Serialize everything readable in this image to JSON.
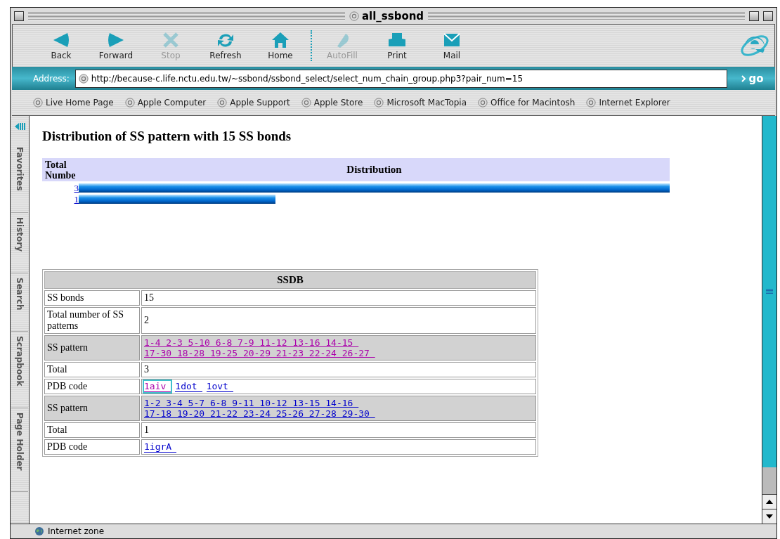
{
  "window": {
    "title": "all_ssbond"
  },
  "toolbar": [
    {
      "label": "Back",
      "disabled": false
    },
    {
      "label": "Forward",
      "disabled": false
    },
    {
      "label": "Stop",
      "disabled": true
    },
    {
      "label": "Refresh",
      "disabled": false
    },
    {
      "label": "Home",
      "disabled": false
    },
    {
      "label": "AutoFill",
      "disabled": true
    },
    {
      "label": "Print",
      "disabled": false
    },
    {
      "label": "Mail",
      "disabled": false
    }
  ],
  "address": {
    "label": "Address:",
    "value": "http://because-c.life.nctu.edu.tw/~ssbond/ssbond_select/select_num_chain_group.php3?pair_num=15",
    "go": "go"
  },
  "favorites": [
    "Live Home Page",
    "Apple Computer",
    "Apple Support",
    "Apple Store",
    "Microsoft MacTopia",
    "Office for Macintosh",
    "Internet Explorer"
  ],
  "sidebar_tabs": [
    "Favorites",
    "History",
    "Search",
    "Scrapbook",
    "Page Holder"
  ],
  "page": {
    "heading": "Distribution of SS pattern with 15 SS bonds",
    "distribution": {
      "columns": [
        "Total Numbe",
        "Distribution"
      ],
      "rows": [
        {
          "count": "3"
        },
        {
          "count": "1"
        }
      ]
    },
    "ssdb": {
      "title": "SSDB",
      "rows": [
        {
          "kind": "text",
          "label": "SS bonds",
          "value": "15"
        },
        {
          "kind": "text",
          "label": "Total number of SS patterns",
          "value": "2"
        },
        {
          "kind": "pattern",
          "label": "SS pattern",
          "lines": [
            "1-4 2-3 5-10 6-8 7-9 11-12 13-16 14-15",
            "17-30 18-28 19-25 20-29 21-23 22-24 26-27"
          ],
          "visited": true
        },
        {
          "kind": "text",
          "label": "Total",
          "value": "3"
        },
        {
          "kind": "codes",
          "label": "PDB code",
          "codes": [
            {
              "text": "1aiv",
              "visited": true,
              "focused": true
            },
            {
              "text": "1dot",
              "visited": false,
              "focused": false
            },
            {
              "text": "1ovt",
              "visited": false,
              "focused": false
            }
          ]
        },
        {
          "kind": "pattern",
          "label": "SS pattern",
          "lines": [
            "1-2 3-4 5-7 6-8 9-11 10-12 13-15 14-16",
            "17-18 19-20 21-22 23-24 25-26 27-28 29-30"
          ],
          "visited": false
        },
        {
          "kind": "text",
          "label": "Total",
          "value": "1"
        },
        {
          "kind": "codes",
          "label": "PDB code",
          "codes": [
            {
              "text": "1igrA",
              "visited": false,
              "focused": false
            }
          ]
        }
      ]
    }
  },
  "status_bar": {
    "text": "Internet zone"
  }
}
